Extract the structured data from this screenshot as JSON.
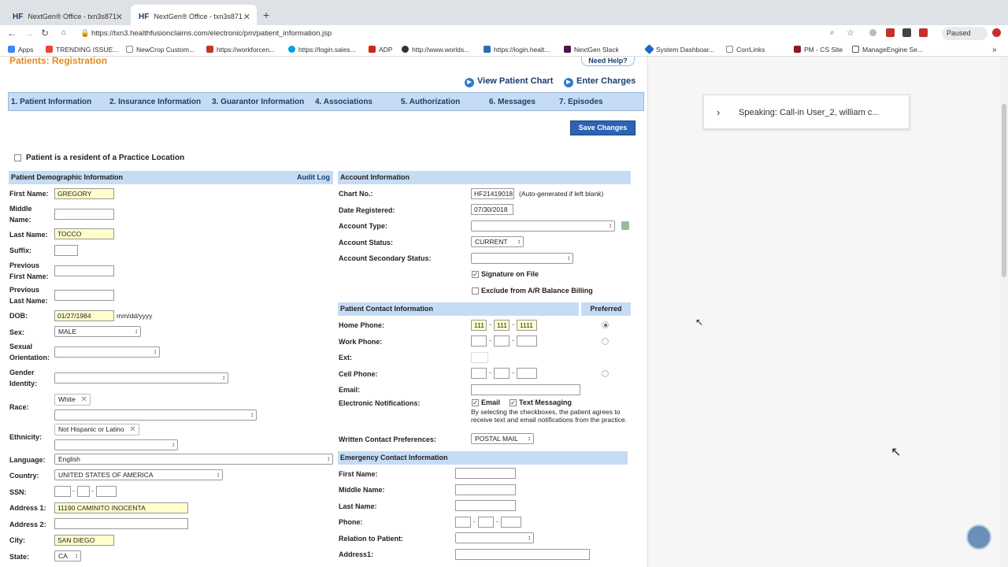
{
  "browser": {
    "tabs": [
      {
        "label": "NextGen® Office - txn3s871"
      },
      {
        "label": "NextGen® Office - txn3s871"
      }
    ],
    "url": "https://txn3.healthfusionclaims.com/electronic/pm/patient_information.jsp",
    "paused_label": "Paused",
    "bookmarks": [
      "Apps",
      "TRENDING ISSUE...",
      "NewCrop Custom...",
      "https://workforcen...",
      "https://login.sales...",
      "ADP",
      "http://www.worlds...",
      "https://login.healt...",
      "NextGen Slack",
      "System Dashboar...",
      "CorrLinks",
      "PM - CS Site",
      "ManageEngine Se..."
    ]
  },
  "header": {
    "title": "Patients: Registration",
    "help": "Need Help?",
    "view_chart": "View Patient Chart",
    "enter_charges": "Enter Charges",
    "save": "Save Changes"
  },
  "steps": [
    "1. Patient Information",
    "2. Insurance Information",
    "3. Guarantor Information",
    "4. Associations",
    "5. Authorization",
    "6. Messages",
    "7. Episodes"
  ],
  "resident_label": "Patient is a resident of a Practice Location",
  "demo": {
    "heading": "Patient Demographic Information",
    "audit": "Audit Log",
    "first_name_lbl": "First Name:",
    "first_name": "GREGORY",
    "middle_lbl1": "Middle",
    "middle_lbl2": "Name:",
    "last_name_lbl": "Last Name:",
    "last_name": "TOCCO",
    "suffix_lbl": "Suffix:",
    "prev_first1": "Previous",
    "prev_first2": "First Name:",
    "prev_last1": "Previous",
    "prev_last2": "Last Name:",
    "dob_lbl": "DOB:",
    "dob": "01/27/1984",
    "dob_fmt": "mm/dd/yyyy",
    "sex_lbl": "Sex:",
    "sex": "MALE",
    "orient1": "Sexual",
    "orient2": "Orientation:",
    "gender1": "Gender",
    "gender2": "Identity:",
    "race_lbl": "Race:",
    "race_tag": "White",
    "eth_lbl": "Ethnicity:",
    "eth_tag": "Not Hispanic or Latino",
    "lang_lbl": "Language:",
    "lang": "English",
    "country_lbl": "Country:",
    "country": "UNITED STATES OF AMERICA",
    "ssn_lbl": "SSN:",
    "addr1_lbl": "Address 1:",
    "addr1": "11190 CAMINITO INOCENTA",
    "addr2_lbl": "Address 2:",
    "city_lbl": "City:",
    "city": "SAN DIEGO",
    "state_lbl": "State:",
    "state": "CA"
  },
  "account": {
    "heading": "Account Information",
    "chart_lbl": "Chart No.:",
    "chart": "HF21419018",
    "chart_note": "(Auto-generated if left blank)",
    "date_lbl": "Date Registered:",
    "date": "07/30/2018",
    "type_lbl": "Account Type:",
    "status_lbl": "Account Status:",
    "status": "CURRENT",
    "sec_lbl": "Account Secondary Status:",
    "sig": "Signature on File",
    "exclude": "Exclude from A/R Balance Billing"
  },
  "contact": {
    "heading": "Patient Contact Information",
    "preferred": "Preferred",
    "home_lbl": "Home Phone:",
    "home": [
      "111",
      "111",
      "1111"
    ],
    "work_lbl": "Work Phone:",
    "ext_lbl": "Ext:",
    "cell_lbl": "Cell Phone:",
    "email_lbl": "Email:",
    "notif_lbl": "Electronic Notifications:",
    "notif_email": "Email",
    "notif_text": "Text Messaging",
    "notif_note": "By selecting the checkboxes, the patient agrees to receive text and email notifications from the practice.",
    "written_lbl": "Written Contact Preferences:",
    "written": "POSTAL MAIL"
  },
  "emergency": {
    "heading": "Emergency Contact Information",
    "first_lbl": "First Name:",
    "middle_lbl": "Middle Name:",
    "last_lbl": "Last Name:",
    "phone_lbl": "Phone:",
    "relation_lbl": "Relation to Patient:",
    "addr_lbl": "Address1:"
  },
  "side": {
    "speaking": "Speaking: Call-in User_2, william c..."
  }
}
